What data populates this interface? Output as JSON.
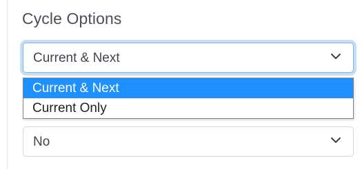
{
  "cycle_options": {
    "label": "Cycle Options",
    "select": {
      "value": "Current & Next",
      "icon": "chevron-down-icon"
    },
    "options": [
      {
        "label": "Current & Next",
        "selected": true
      },
      {
        "label": "Current Only",
        "selected": false
      }
    ]
  },
  "second_select": {
    "value": "No",
    "icon": "chevron-down-icon"
  },
  "colors": {
    "selected_option_bg": "#1e90ff",
    "focus_ring": "#c9def6",
    "focus_border": "#80b4ec"
  }
}
